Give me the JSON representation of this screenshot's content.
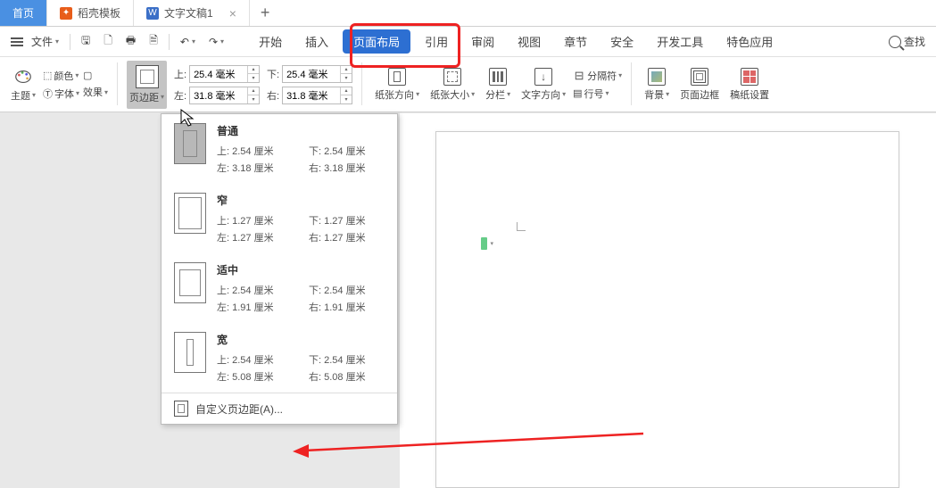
{
  "tabs": {
    "home": "首页",
    "daoke": "稻壳模板",
    "doc": "文字文稿1",
    "close": "×",
    "add": "+"
  },
  "toolbar": {
    "file": "文件",
    "quick": {
      "save": "⎙",
      "new": "🗋",
      "print": "🖶",
      "preview": "🗎",
      "undo": "↶",
      "redo": "↷"
    }
  },
  "menu": {
    "start": "开始",
    "insert": "插入",
    "layout": "页面布局",
    "ref": "引用",
    "review": "审阅",
    "view": "视图",
    "chapter": "章节",
    "security": "安全",
    "dev": "开发工具",
    "special": "特色应用",
    "search": "查找"
  },
  "ribbon": {
    "theme": "主题",
    "color": "颜色",
    "font": "字体",
    "effects": "效果",
    "margin": "页边距",
    "margins": {
      "top_l": "上:",
      "top_v": "25.4 毫米",
      "left_l": "左:",
      "left_v": "31.8 毫米",
      "bottom_l": "下:",
      "bottom_v": "25.4 毫米",
      "right_l": "右:",
      "right_v": "31.8 毫米"
    },
    "orient": "纸张方向",
    "size": "纸张大小",
    "cols": "分栏",
    "txtdir": "文字方向",
    "break": "分隔符",
    "lineno": "行号",
    "bg": "背景",
    "border": "页面边框",
    "grid": "稿纸设置"
  },
  "dropdown": {
    "items": [
      {
        "name": "普通",
        "t": "上: 2.54 厘米",
        "b": "下: 2.54 厘米",
        "l": "左: 3.18 厘米",
        "r": "右: 3.18 厘米"
      },
      {
        "name": "窄",
        "t": "上: 1.27 厘米",
        "b": "下: 1.27 厘米",
        "l": "左: 1.27 厘米",
        "r": "右: 1.27 厘米"
      },
      {
        "name": "适中",
        "t": "上: 2.54 厘米",
        "b": "下: 2.54 厘米",
        "l": "左: 1.91 厘米",
        "r": "右: 1.91 厘米"
      },
      {
        "name": "宽",
        "t": "上: 2.54 厘米",
        "b": "下: 2.54 厘米",
        "l": "左: 5.08 厘米",
        "r": "右: 5.08 厘米"
      }
    ],
    "custom": "自定义页边距(A)..."
  }
}
